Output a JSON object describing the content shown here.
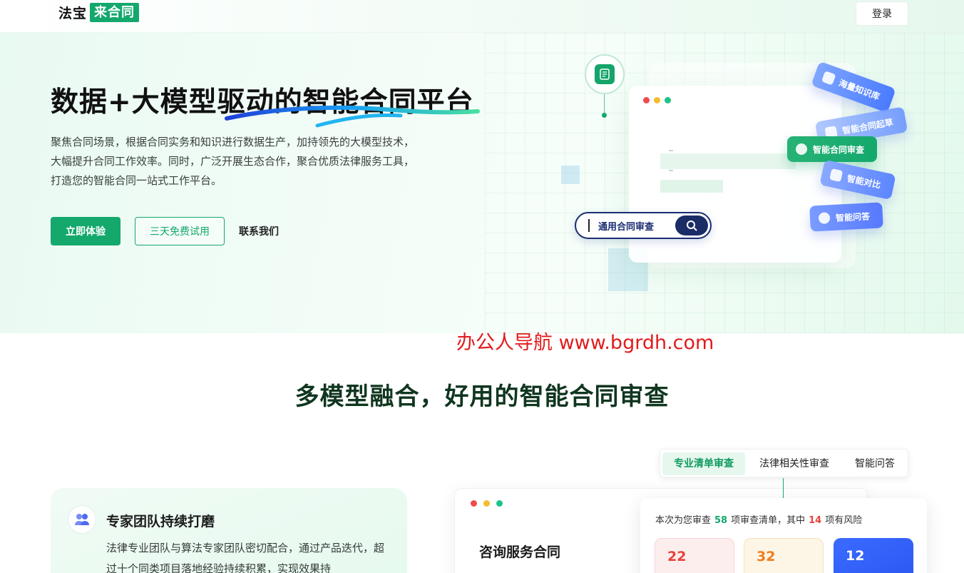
{
  "header": {
    "logo_prefix": "法宝",
    "logo_name": "来合同",
    "login_label": "登录"
  },
  "hero": {
    "title": "数据+大模型驱动的智能合同平台",
    "description": "聚焦合同场景，根据合同实务和知识进行数据生产，加持领先的大模型技术，大幅提升合同工作效率。同时，广泛开展生态合作，聚合优质法律服务工具，打造您的智能合同一站式工作平台。",
    "btn_try": "立即体验",
    "btn_trial": "三天免费试用",
    "btn_contact": "联系我们",
    "search_text": "通用合同审查",
    "tags": [
      "海量知识库",
      "智能合同起草",
      "智能合同审查",
      "智能对比",
      "智能问答"
    ]
  },
  "watermark": "办公人导航 www.bgrdh.com",
  "section2": {
    "title": "多模型融合，好用的智能合同审查",
    "card_title": "专家团队持续打磨",
    "card_desc": "法律专业团队与算法专家团队密切配合，通过产品迭代，超过十个同类项目落地经验持续积累，实现效果持",
    "tabs": [
      "专业清单审查",
      "法律相关性审查",
      "智能问答"
    ],
    "active_tab": "专业清单审查",
    "app_title": "咨询服务合同",
    "result_prefix": "本次为您审查",
    "result_count": "58",
    "result_mid": "项审查清单，其中",
    "risk_count": "14",
    "result_suffix": "项有风险",
    "stats": [
      "22",
      "32",
      "12"
    ]
  },
  "colors": {
    "brand_green": "#14a86c",
    "risk_red": "#e7423a",
    "warn_orange": "#ef7d1b",
    "info_blue": "#2b56f2",
    "watermark_red": "#e11b1b"
  }
}
